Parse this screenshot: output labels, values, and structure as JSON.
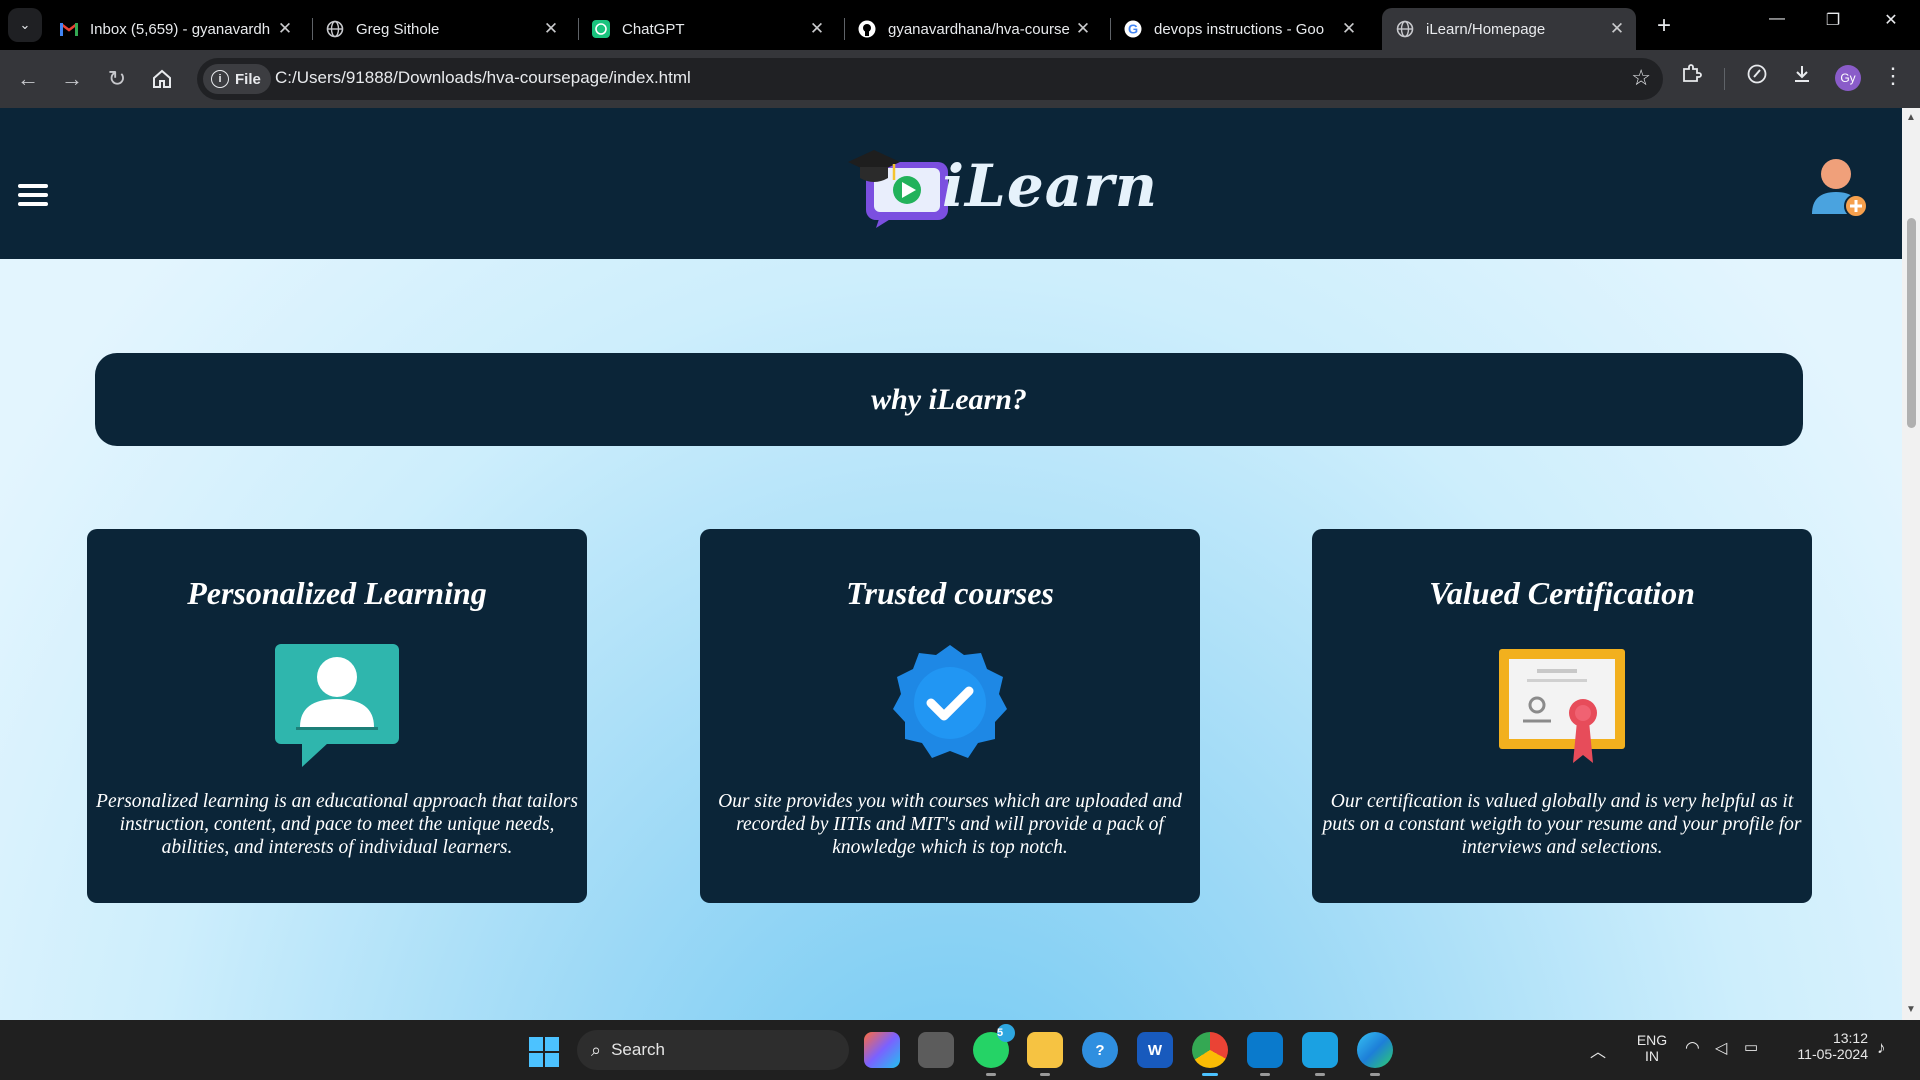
{
  "browser": {
    "tabs": [
      {
        "title": "Inbox (5,659) - gyanavardh",
        "icon": "gmail-icon",
        "active": false
      },
      {
        "title": "Greg Sithole",
        "icon": "globe-icon",
        "active": false
      },
      {
        "title": "ChatGPT",
        "icon": "chatgpt-icon",
        "active": false
      },
      {
        "title": "gyanavardhana/hva-course",
        "icon": "github-icon",
        "active": false
      },
      {
        "title": "devops instructions - Goo",
        "icon": "google-icon",
        "active": false
      },
      {
        "title": "iLearn/Homepage",
        "icon": "globe-icon",
        "active": true
      }
    ],
    "chip_label": "File",
    "url": "C:/Users/91888/Downloads/hva-coursepage/index.html",
    "profile_initials": "Gy"
  },
  "site": {
    "brand": "iLearn",
    "why_title": "why iLearn?",
    "cards": [
      {
        "title": "Personalized Learning",
        "icon": "learner-chat-icon",
        "text": "Personalized learning is an educational approach that tailors instruction, content, and pace to meet the unique needs, abilities, and interests of individual learners."
      },
      {
        "title": "Trusted courses",
        "icon": "verified-badge-icon",
        "text": "Our site provides you with courses which are uploaded and recorded by IITIs and MIT's and will provide a pack of knowledge which is top notch."
      },
      {
        "title": "Valued Certification",
        "icon": "certificate-icon",
        "text": "Our certification is valued globally and is very helpful as it puts on a constant weigth to your resume and your profile for interviews and selections."
      }
    ]
  },
  "taskbar": {
    "search_label": "Search",
    "whatsapp_badge": "5",
    "lang_line1": "ENG",
    "lang_line2": "IN",
    "time": "13:12",
    "date": "11-05-2024"
  },
  "colors": {
    "header_bg": "#0b2538",
    "card_bg": "#0b2538",
    "accent_teal": "#2fb6ad",
    "badge_blue": "#1e88e5",
    "cert_gold": "#f2b01e"
  }
}
